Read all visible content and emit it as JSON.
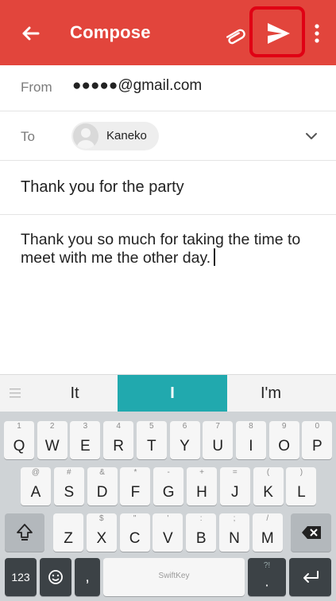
{
  "toolbar": {
    "back_icon": "arrow-left-icon",
    "title": "Compose",
    "attach_icon": "paperclip-icon",
    "send_icon": "send-icon",
    "more_icon": "more-vert-icon",
    "bg_color": "#e2453c",
    "highlight_color": "#e00014"
  },
  "from": {
    "label": "From",
    "value": "●●●●●@gmail.com"
  },
  "to": {
    "label": "To",
    "chip_name": "Kaneko",
    "expand_icon": "chevron-down-icon"
  },
  "subject": {
    "value": "Thank you for the party"
  },
  "body": {
    "value": "Thank you so much for taking the time to meet with me the other day."
  },
  "suggestions": {
    "menu_icon": "menu-icon",
    "items": [
      "It",
      "I",
      "I'm"
    ],
    "selected_color": "#21a9ae"
  },
  "keyboard": {
    "row1": [
      {
        "main": "Q",
        "hint": "1"
      },
      {
        "main": "W",
        "hint": "2"
      },
      {
        "main": "E",
        "hint": "3"
      },
      {
        "main": "R",
        "hint": "4"
      },
      {
        "main": "T",
        "hint": "5"
      },
      {
        "main": "Y",
        "hint": "6"
      },
      {
        "main": "U",
        "hint": "7"
      },
      {
        "main": "I",
        "hint": "8"
      },
      {
        "main": "O",
        "hint": "9"
      },
      {
        "main": "P",
        "hint": "0"
      }
    ],
    "row2": [
      {
        "main": "A",
        "hint": "@"
      },
      {
        "main": "S",
        "hint": "#"
      },
      {
        "main": "D",
        "hint": "&"
      },
      {
        "main": "F",
        "hint": "*"
      },
      {
        "main": "G",
        "hint": "-"
      },
      {
        "main": "H",
        "hint": "+"
      },
      {
        "main": "J",
        "hint": "="
      },
      {
        "main": "K",
        "hint": "("
      },
      {
        "main": "L",
        "hint": ")"
      }
    ],
    "row3": [
      {
        "main": "Z",
        "hint": ""
      },
      {
        "main": "X",
        "hint": "$"
      },
      {
        "main": "C",
        "hint": "\""
      },
      {
        "main": "V",
        "hint": "'"
      },
      {
        "main": "B",
        "hint": ":"
      },
      {
        "main": "N",
        "hint": ";"
      },
      {
        "main": "M",
        "hint": "/"
      }
    ],
    "shift_icon": "shift-icon",
    "backspace_icon": "backspace-icon",
    "numbers_label": "123",
    "emoji_icon": "emoji-icon",
    "comma_label": ",",
    "space_label": "SwiftKey",
    "period_label": ".",
    "period_hint": "?!",
    "enter_icon": "enter-icon"
  }
}
